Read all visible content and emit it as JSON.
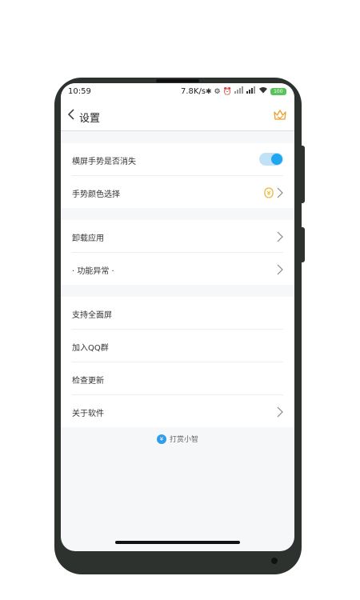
{
  "status_bar": {
    "time": "10:59",
    "net_speed": "7.8K/s",
    "battery": "100"
  },
  "nav": {
    "title": "设置"
  },
  "section1": {
    "rows": [
      {
        "label": "横屏手势是否消失"
      },
      {
        "label": "手势颜色选择"
      }
    ]
  },
  "section2": {
    "rows": [
      {
        "label": "卸载应用"
      },
      {
        "label": "· 功能异常 ·"
      }
    ]
  },
  "section3": {
    "rows": [
      {
        "label": "支持全面屏"
      },
      {
        "label": "加入QQ群"
      },
      {
        "label": "检查更新"
      },
      {
        "label": "关于软件"
      }
    ]
  },
  "reward": {
    "icon_text": "¥",
    "label": "打赏小智"
  },
  "toggle_on": true,
  "colors": {
    "accent": "#1ea7f0",
    "coin": "#e8b93a",
    "phone_frame": "#2e322f"
  }
}
